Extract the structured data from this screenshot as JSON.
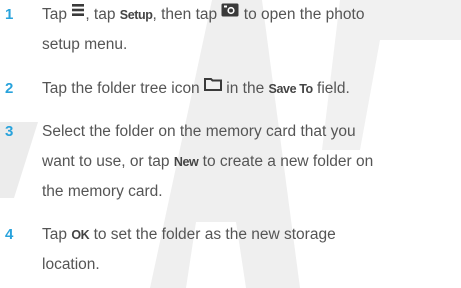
{
  "watermark": {
    "color": "#ececec"
  },
  "colors": {
    "step_number": "#29a3dc",
    "body_text": "#555555"
  },
  "steps": [
    {
      "number": "1",
      "line1": {
        "a": "Tap ",
        "b": ", tap ",
        "kw1": "Setup",
        "c": ", then tap ",
        "d": " to open the photo"
      },
      "line2": "setup menu.",
      "icons": [
        "menu-icon",
        "camera-icon"
      ]
    },
    {
      "number": "2",
      "line1": {
        "a": "Tap the folder tree icon ",
        "b": " in the ",
        "kw1": "Save To",
        "c": " field."
      },
      "icons": [
        "folder-icon"
      ]
    },
    {
      "number": "3",
      "line1": "Select the folder on the memory card that you",
      "line2": {
        "a": "want to use, or tap ",
        "kw1": "New",
        "b": " to create a new folder on"
      },
      "line3": "the memory card."
    },
    {
      "number": "4",
      "line1": {
        "a": "Tap ",
        "kw1": "OK",
        "b": " to set the folder as the new storage"
      },
      "line2": "location."
    }
  ]
}
